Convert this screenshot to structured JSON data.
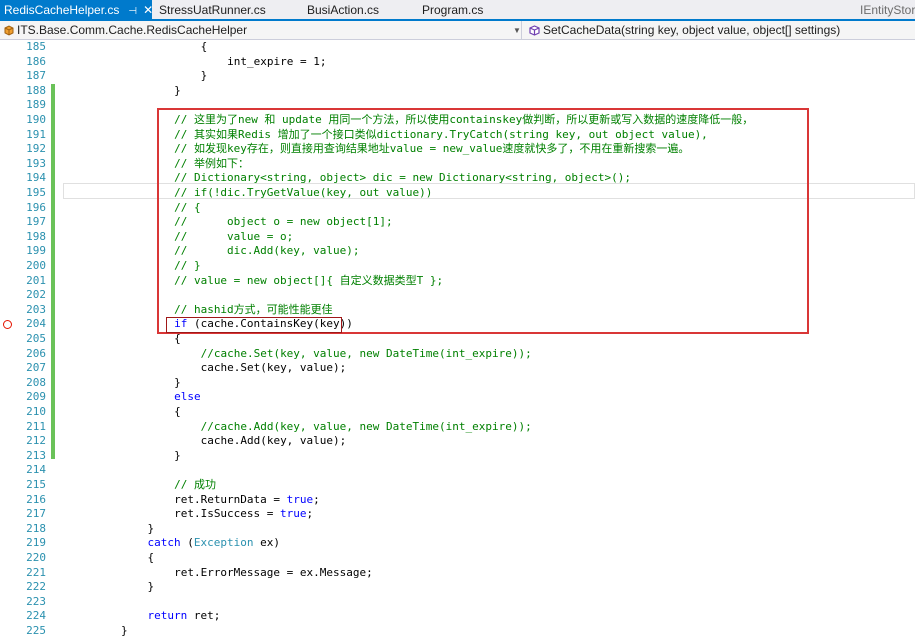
{
  "tabs": [
    {
      "label": "RedisCacheHelper.cs",
      "active": true,
      "pin": "⊣",
      "close": "✕"
    },
    {
      "label": "StressUatRunner.cs",
      "active": false
    },
    {
      "label": "BusiAction.cs",
      "active": false
    },
    {
      "label": "Program.cs",
      "active": false
    },
    {
      "label": "IEntityStor",
      "active": false
    }
  ],
  "navbar": {
    "class_path": "ITS.Base.Comm.Cache.RedisCacheHelper",
    "member": "SetCacheData(string key, object value, object[] settings)",
    "class_icon": "class-icon",
    "member_icon": "method-icon"
  },
  "colors": {
    "accent": "#007acc",
    "comment": "#008000",
    "keyword": "#0000ff",
    "type": "#2b91af",
    "line_number": "#2b91af",
    "highlight_box": "#d93636",
    "change_bar": "#6ac259",
    "breakpoint": "#e51400"
  },
  "editor": {
    "lines": [
      {
        "n": "185",
        "indent": 10,
        "parts": [
          {
            "t": "{"
          }
        ]
      },
      {
        "n": "186",
        "indent": 12,
        "parts": [
          {
            "t": "int_expire = 1;"
          }
        ]
      },
      {
        "n": "187",
        "indent": 10,
        "parts": [
          {
            "t": "}"
          }
        ]
      },
      {
        "n": "188",
        "indent": 8,
        "parts": [
          {
            "t": "}"
          }
        ]
      },
      {
        "n": "189",
        "indent": 0,
        "parts": []
      },
      {
        "n": "190",
        "indent": 8,
        "parts": [
          {
            "t": "// 这里为了new 和 update 用同一个方法，所以使用containskey做判断，所以更新或写入数据的速度降低一般，",
            "c": "comment"
          }
        ]
      },
      {
        "n": "191",
        "indent": 8,
        "parts": [
          {
            "t": "// 其实如果Redis 增加了一个接口类似dictionary.TryCatch(string key, out object value),",
            "c": "comment"
          }
        ]
      },
      {
        "n": "192",
        "indent": 8,
        "parts": [
          {
            "t": "// 如发现key存在，则直接用查询结果地址value = new_value速度就快多了，不用在重新搜索一遍。",
            "c": "comment"
          }
        ]
      },
      {
        "n": "193",
        "indent": 8,
        "parts": [
          {
            "t": "// 举例如下：",
            "c": "comment"
          }
        ]
      },
      {
        "n": "194",
        "indent": 8,
        "parts": [
          {
            "t": "// Dictionary<string, object> dic = new Dictionary<string, object>();",
            "c": "comment"
          }
        ]
      },
      {
        "n": "195",
        "indent": 8,
        "parts": [
          {
            "t": "// if(!dic.TryGetValue(key, out value))",
            "c": "comment"
          }
        ]
      },
      {
        "n": "196",
        "indent": 8,
        "parts": [
          {
            "t": "// {",
            "c": "comment"
          }
        ]
      },
      {
        "n": "197",
        "indent": 8,
        "parts": [
          {
            "t": "//      object o = new object[1];",
            "c": "comment"
          }
        ]
      },
      {
        "n": "198",
        "indent": 8,
        "parts": [
          {
            "t": "//      value = o;",
            "c": "comment"
          }
        ]
      },
      {
        "n": "199",
        "indent": 8,
        "parts": [
          {
            "t": "//      dic.Add(key, value);",
            "c": "comment"
          }
        ]
      },
      {
        "n": "200",
        "indent": 8,
        "parts": [
          {
            "t": "// }",
            "c": "comment"
          }
        ]
      },
      {
        "n": "201",
        "indent": 8,
        "parts": [
          {
            "t": "// value = new object[]{ 自定义数据类型T };",
            "c": "comment"
          }
        ]
      },
      {
        "n": "202",
        "indent": 0,
        "parts": []
      },
      {
        "n": "203",
        "indent": 8,
        "parts": [
          {
            "t": "// hashid方式，可能性能更佳",
            "c": "comment"
          }
        ]
      },
      {
        "n": "204",
        "indent": 8,
        "parts": [
          {
            "t": "if",
            "c": "keyword"
          },
          {
            "t": " (cache.ContainsKey(key))"
          }
        ]
      },
      {
        "n": "205",
        "indent": 8,
        "parts": [
          {
            "t": "{"
          }
        ]
      },
      {
        "n": "206",
        "indent": 10,
        "parts": [
          {
            "t": "//cache.Set(key, value, new DateTime(int_expire));",
            "c": "comment"
          }
        ]
      },
      {
        "n": "207",
        "indent": 10,
        "parts": [
          {
            "t": "cache.Set(key, value);"
          }
        ]
      },
      {
        "n": "208",
        "indent": 8,
        "parts": [
          {
            "t": "}"
          }
        ]
      },
      {
        "n": "209",
        "indent": 8,
        "parts": [
          {
            "t": "else",
            "c": "keyword"
          }
        ]
      },
      {
        "n": "210",
        "indent": 8,
        "parts": [
          {
            "t": "{"
          }
        ]
      },
      {
        "n": "211",
        "indent": 10,
        "parts": [
          {
            "t": "//cache.Add(key, value, new DateTime(int_expire));",
            "c": "comment"
          }
        ]
      },
      {
        "n": "212",
        "indent": 10,
        "parts": [
          {
            "t": "cache.Add(key, value);"
          }
        ]
      },
      {
        "n": "213",
        "indent": 8,
        "parts": [
          {
            "t": "}"
          }
        ]
      },
      {
        "n": "214",
        "indent": 0,
        "parts": []
      },
      {
        "n": "215",
        "indent": 8,
        "parts": [
          {
            "t": "// 成功",
            "c": "comment"
          }
        ]
      },
      {
        "n": "216",
        "indent": 8,
        "parts": [
          {
            "t": "ret.ReturnData = "
          },
          {
            "t": "true",
            "c": "keyword"
          },
          {
            "t": ";"
          }
        ]
      },
      {
        "n": "217",
        "indent": 8,
        "parts": [
          {
            "t": "ret.IsSuccess = "
          },
          {
            "t": "true",
            "c": "keyword"
          },
          {
            "t": ";"
          }
        ]
      },
      {
        "n": "218",
        "indent": 6,
        "parts": [
          {
            "t": "}"
          }
        ]
      },
      {
        "n": "219",
        "indent": 6,
        "parts": [
          {
            "t": "catch",
            "c": "keyword"
          },
          {
            "t": " ("
          },
          {
            "t": "Exception",
            "c": "type"
          },
          {
            "t": " ex)"
          }
        ]
      },
      {
        "n": "220",
        "indent": 6,
        "parts": [
          {
            "t": "{"
          }
        ]
      },
      {
        "n": "221",
        "indent": 8,
        "parts": [
          {
            "t": "ret.ErrorMessage = ex.Message;"
          }
        ]
      },
      {
        "n": "222",
        "indent": 6,
        "parts": [
          {
            "t": "}"
          }
        ]
      },
      {
        "n": "223",
        "indent": 0,
        "parts": []
      },
      {
        "n": "224",
        "indent": 6,
        "parts": [
          {
            "t": "return",
            "c": "keyword"
          },
          {
            "t": " ret;"
          }
        ]
      },
      {
        "n": "225",
        "indent": 4,
        "parts": [
          {
            "t": "}"
          }
        ]
      }
    ]
  }
}
